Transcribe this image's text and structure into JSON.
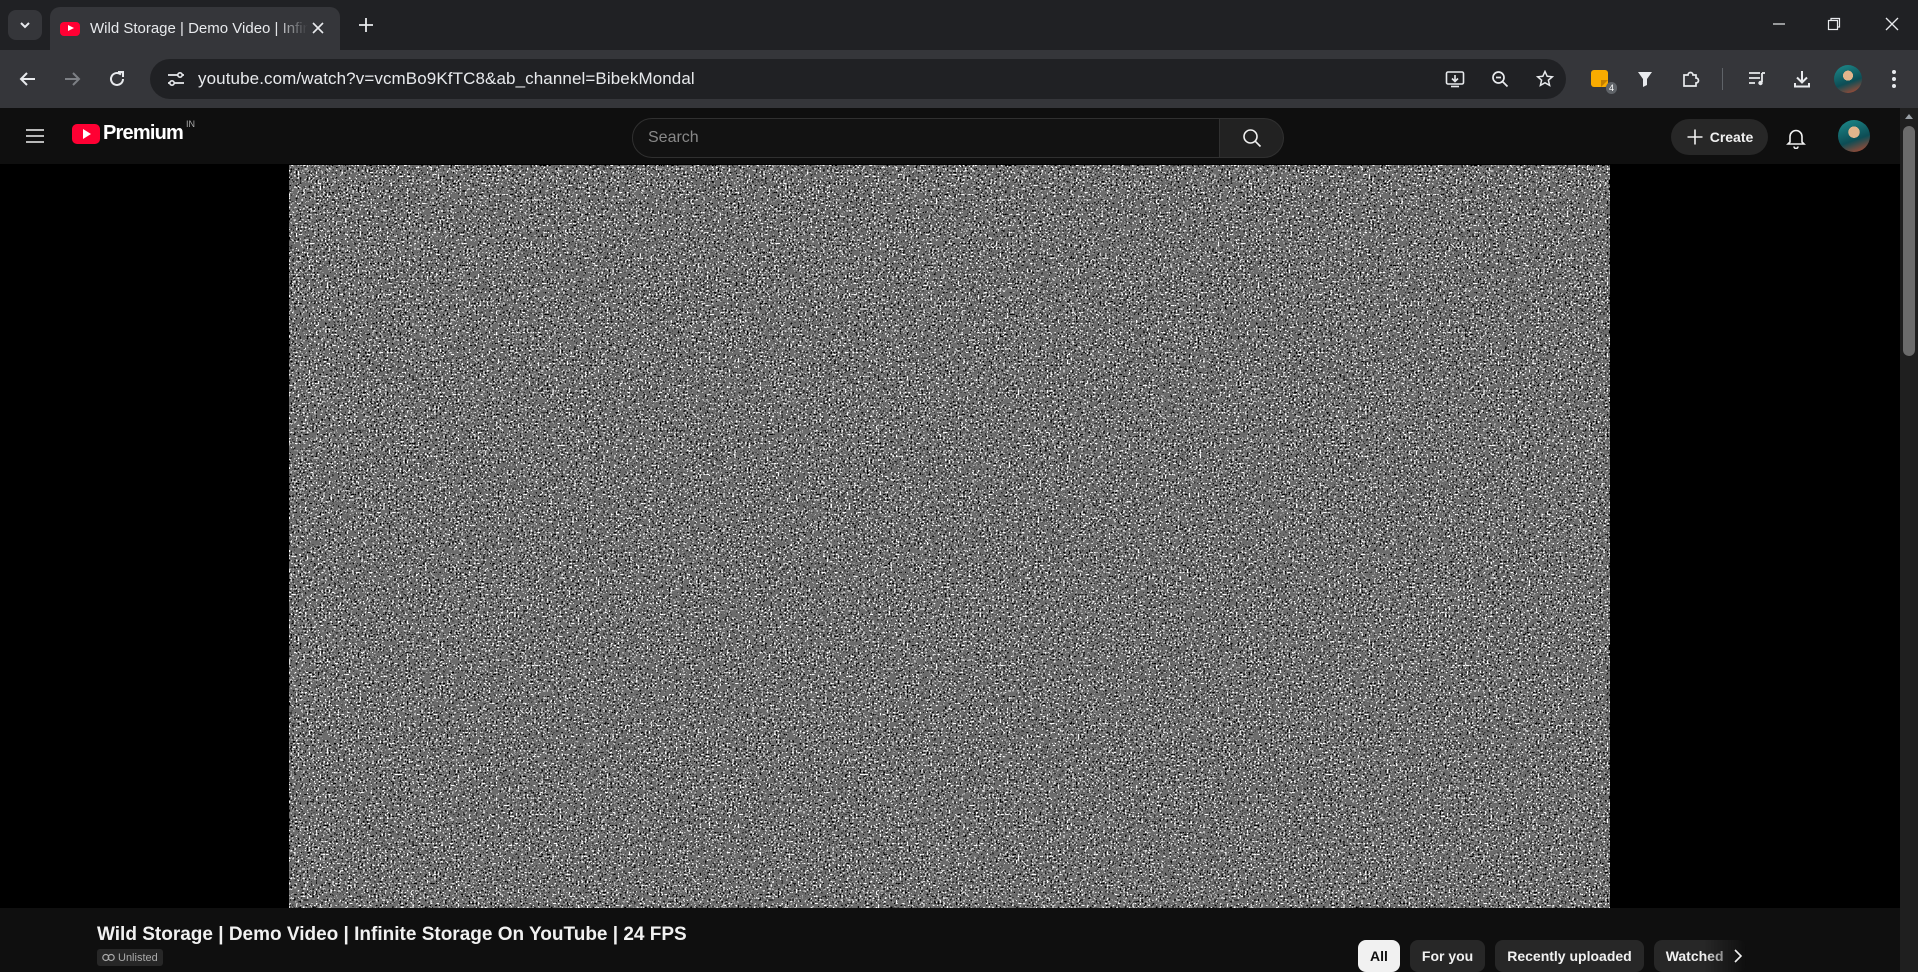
{
  "browser": {
    "tab": {
      "title": "Wild Storage | Demo Video | Infinite Storage On YouTube | 24 FPS",
      "favicon": "youtube-icon"
    },
    "address_bar": {
      "url": "youtube.com/watch?v=vcmBo9KfTC8&ab_channel=BibekMondal"
    },
    "extension_badge": "4",
    "colors": {
      "frame": "#202124",
      "toolbar": "#35363a",
      "omnibox": "#202124",
      "extension_accent": "#f9ab00"
    }
  },
  "youtube": {
    "logo": {
      "text": "Premium",
      "country": "IN"
    },
    "search": {
      "placeholder": "Search"
    },
    "create_label": "Create",
    "colors": {
      "brand_red": "#ff0033",
      "background": "#0f0f0f",
      "chip_active": "#f1f1f1"
    }
  },
  "video": {
    "title": "Wild Storage | Demo Video | Infinite Storage On YouTube | 24 FPS",
    "visibility": "Unlisted",
    "content": "static-noise"
  },
  "chips": [
    {
      "label": "All",
      "active": true
    },
    {
      "label": "For you",
      "active": false
    },
    {
      "label": "Recently uploaded",
      "active": false
    },
    {
      "label": "Watched",
      "active": false
    }
  ]
}
